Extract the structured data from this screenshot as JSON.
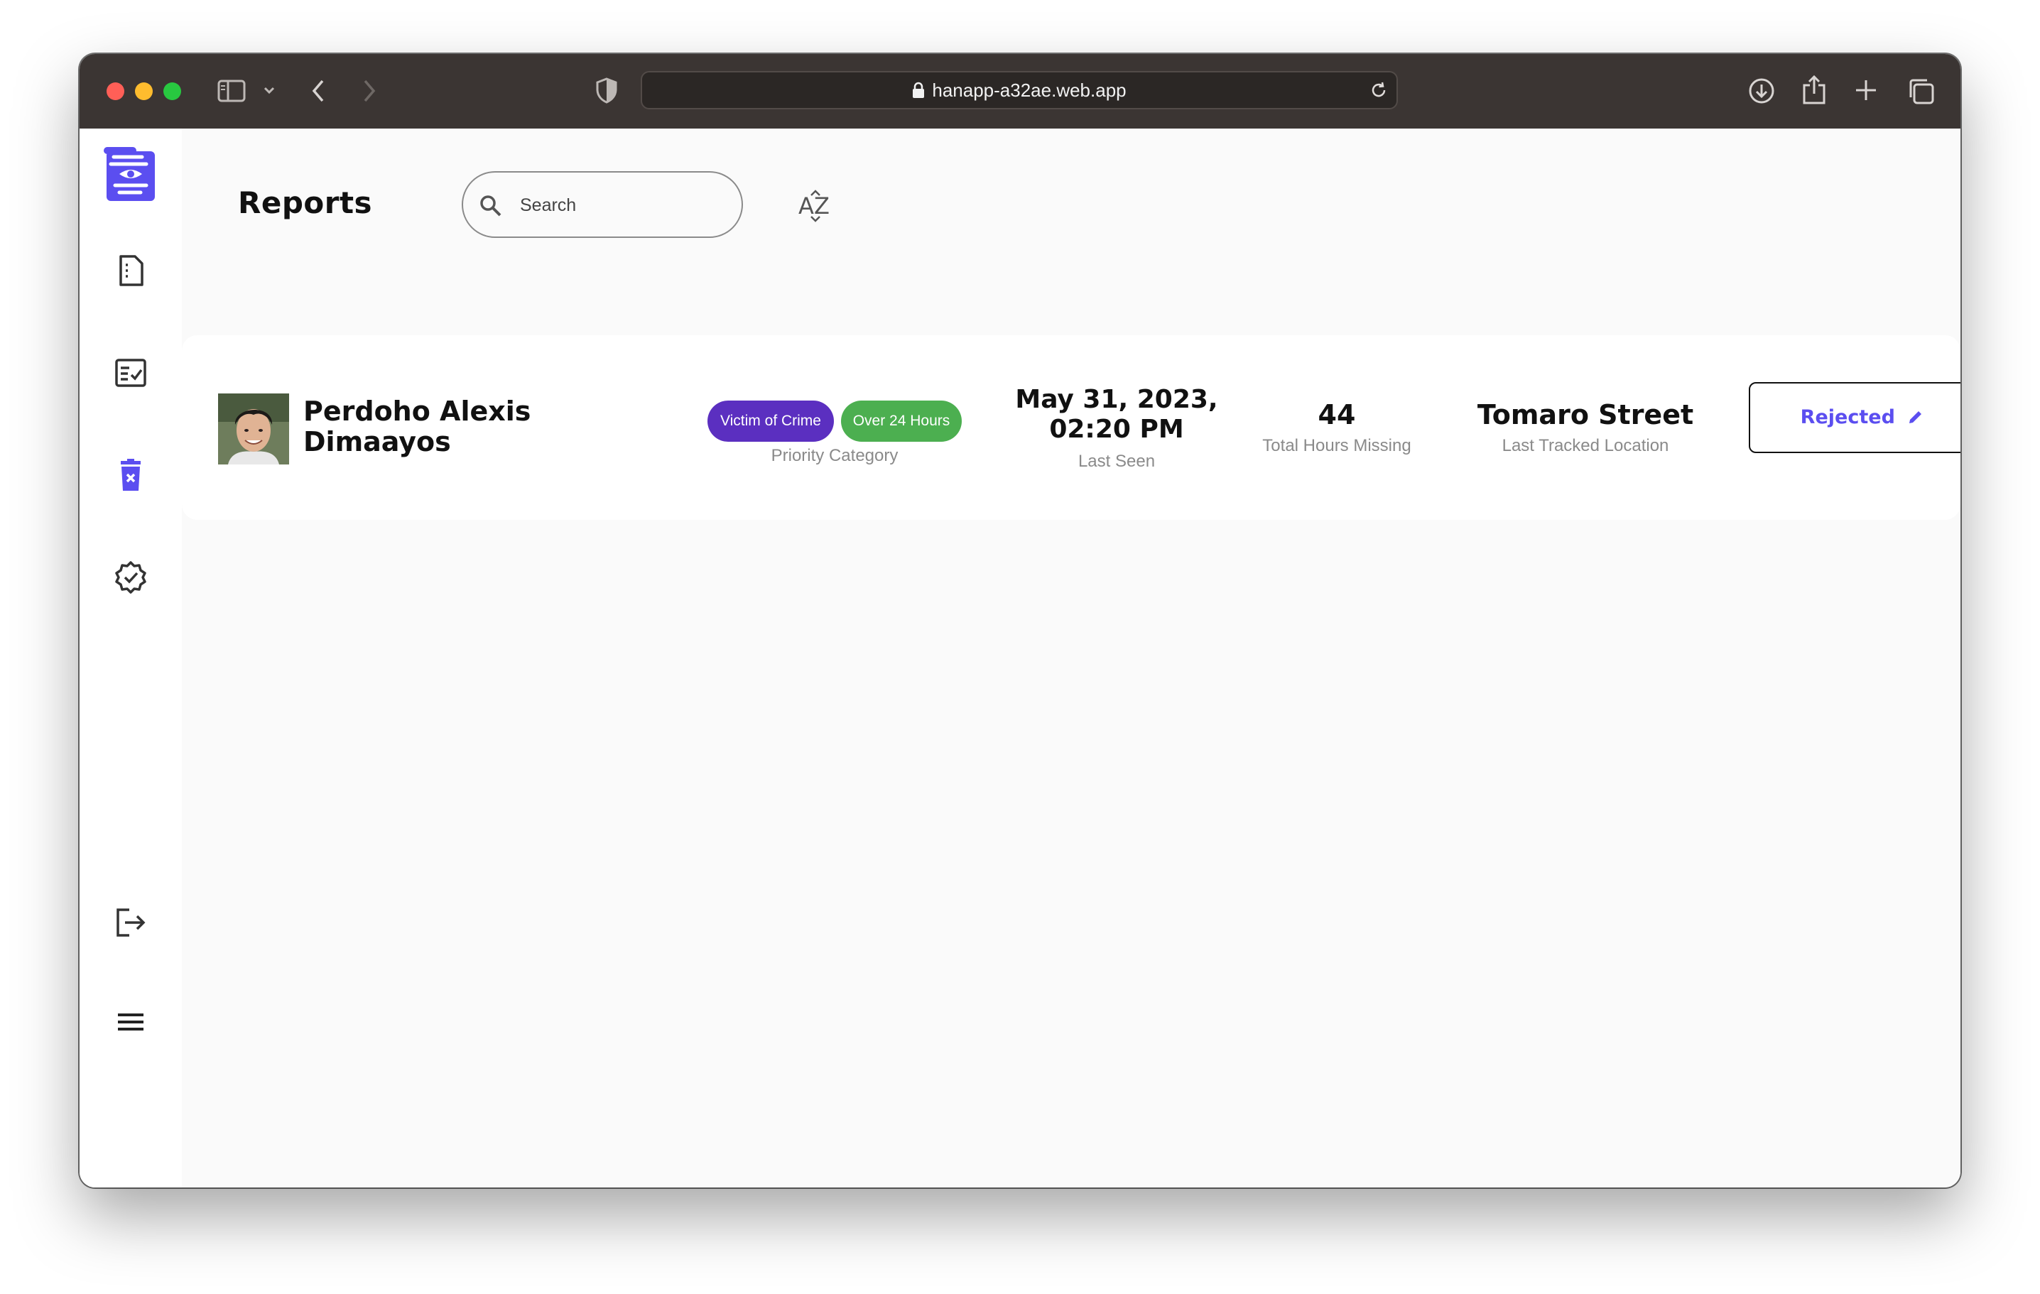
{
  "browser": {
    "url": "hanapp-a32ae.web.app",
    "colors": {
      "close": "#ff5f57",
      "minimize": "#febc2e",
      "zoom": "#28c840"
    },
    "icons": [
      "sidebar-toggle-icon",
      "chevron-down-icon",
      "back-icon",
      "forward-icon",
      "shield-icon",
      "lock-icon",
      "reload-icon",
      "download-icon",
      "share-icon",
      "new-tab-icon",
      "tabs-overview-icon"
    ]
  },
  "sidebar": {
    "items": [
      {
        "icon": "logo-icon"
      },
      {
        "icon": "document-icon"
      },
      {
        "icon": "checklist-icon"
      },
      {
        "icon": "trash-icon",
        "active": true
      },
      {
        "icon": "verified-badge-icon"
      },
      {
        "icon": "logout-icon"
      },
      {
        "icon": "menu-icon"
      }
    ],
    "accent": "#5b4ef0"
  },
  "header": {
    "title": "Reports",
    "search_placeholder": "Search",
    "sort_icon": "sort-az-icon"
  },
  "reports": [
    {
      "name_line1": "Perdoho Alexis",
      "name_line2": "Dimaayos",
      "badges": [
        {
          "label": "Victim of Crime",
          "color": "#5b2fc0"
        },
        {
          "label": "Over 24 Hours",
          "color": "#4caf50"
        }
      ],
      "priority_label": "Priority Category",
      "last_seen_line1": "May 31, 2023,",
      "last_seen_line2": "02:20 PM",
      "last_seen_label": "Last Seen",
      "hours_missing": "44",
      "hours_missing_label": "Total Hours Missing",
      "location": "Tomaro Street",
      "location_label": "Last Tracked Location",
      "status": "Rejected",
      "status_color": "#5b4ef0"
    }
  ]
}
